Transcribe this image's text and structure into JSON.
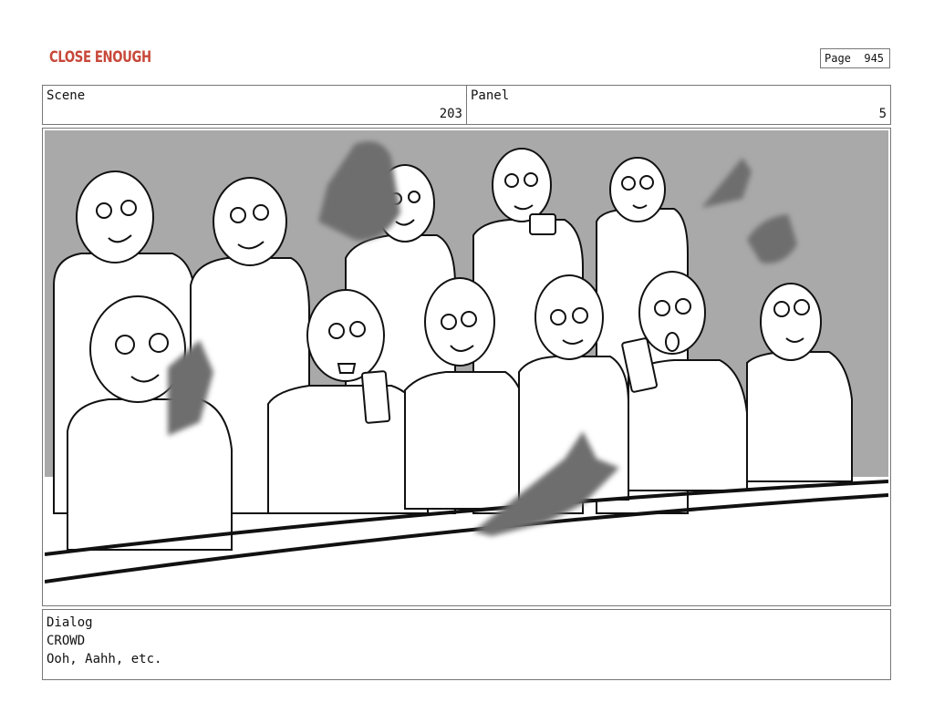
{
  "header": {
    "logo_text": "CLOSE ENOUGH",
    "page_label": "Page",
    "page_number": "945"
  },
  "scene": {
    "label": "Scene",
    "value": "203"
  },
  "panel": {
    "label": "Panel",
    "value": "5"
  },
  "dialog": {
    "label": "Dialog",
    "character": "CROWD",
    "line": "Ooh, Aahh, etc."
  },
  "colors": {
    "logo": "#c8483a",
    "border": "#777777",
    "sketch_gray": "#a9a9a9",
    "sketch_dark": "#6e6e6e"
  }
}
